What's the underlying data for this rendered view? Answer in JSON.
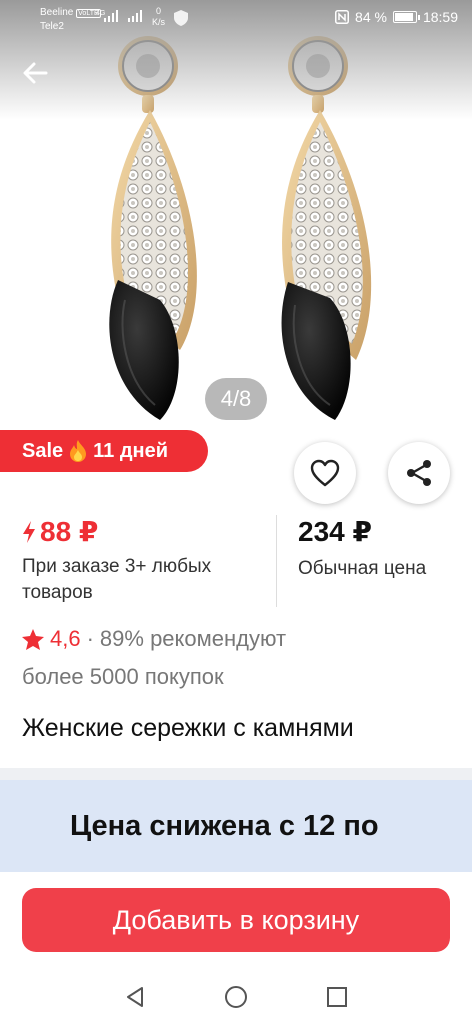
{
  "status_bar": {
    "carrier1": "Beeline",
    "carrier2": "Tele2",
    "volte": "VoLTE",
    "net": "4G",
    "speed_value": "0",
    "speed_unit": "K/s",
    "battery": "84 %",
    "battery_level": 0.84,
    "time": "18:59"
  },
  "gallery": {
    "counter": "4/8"
  },
  "sale_badge": {
    "label": "Sale",
    "days": "11 дней"
  },
  "price": {
    "discount": "88 ₽",
    "discount_note": "При заказе 3+ любых товаров",
    "regular": "234 ₽",
    "regular_note": "Обычная цена"
  },
  "rating": {
    "score": "4,6",
    "separator": "·",
    "recommend": "89% рекомендуют",
    "buyers": "более 5000 покупок"
  },
  "product": {
    "title": "Женские сережки с камнями"
  },
  "promo": {
    "text": "Цена снижена с 12 по"
  },
  "actions": {
    "add_to_cart": "Добавить в корзину"
  },
  "colors": {
    "accent_red": "#ee2f35",
    "promo_bg": "#dce6f6"
  }
}
